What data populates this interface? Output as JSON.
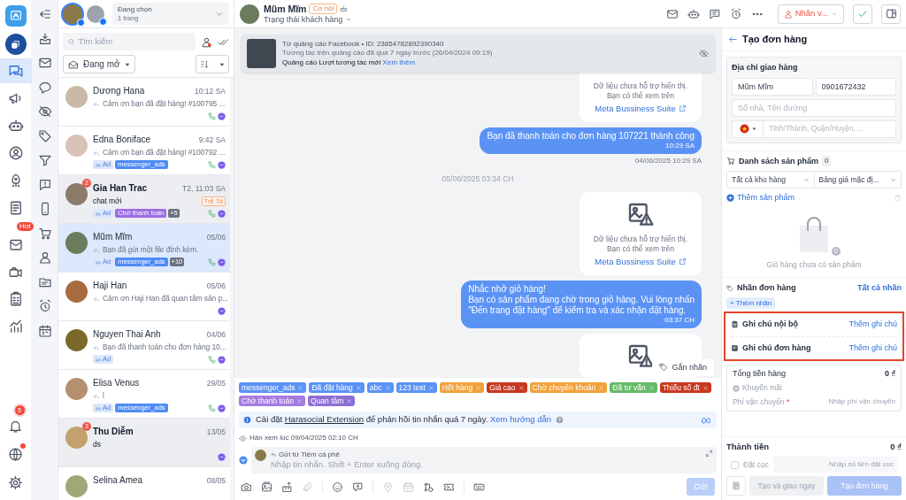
{
  "rail": {
    "items": [
      {
        "selected": true
      },
      {
        "selected": false
      },
      {
        "selected": false
      },
      {
        "selected": false
      },
      {
        "selected": false
      },
      {
        "selected": false
      },
      {
        "selected": false,
        "badge": "Hot"
      },
      {
        "selected": false
      },
      {
        "selected": false
      },
      {
        "selected": false
      }
    ],
    "bottom": [
      {
        "badge": "5",
        "alert": false
      },
      {
        "alert": true
      },
      {
        "alert": false
      }
    ]
  },
  "conversation_list": {
    "pages": {
      "label": "Đang chọn",
      "value": "1 trang"
    },
    "search": {
      "placeholder": "Tìm kiếm"
    },
    "status_filter": "Đang mở",
    "conversations": [
      {
        "name": "Dương Hana",
        "time": "10:12 SA",
        "preview": "Cảm ơn bạn đã đặt hàng! #100795 ...",
        "replied": true,
        "phone": true,
        "selected": false
      },
      {
        "name": "Edna Boniface",
        "time": "9:42 SA",
        "preview": "Cảm ơn bạn đã đặt hàng! #100792 ...",
        "replied": true,
        "tags": [
          {
            "kind": "ad",
            "text": "Ad"
          },
          {
            "kind": "label",
            "text": "messenger_ads",
            "color": "#4f8bf5"
          }
        ],
        "phone": true,
        "selected": false
      },
      {
        "name": "Gia Han Trac",
        "time": "T2, 11:03 SA",
        "preview": "chat mới",
        "replied": false,
        "unread": "2",
        "late": "Trễ 7d",
        "tags": [
          {
            "kind": "ad",
            "text": "Ad"
          },
          {
            "kind": "label",
            "text": "Chờ thanh toán",
            "color": "#9b6fe3"
          },
          {
            "kind": "more",
            "text": "+5"
          }
        ],
        "phone": true,
        "selected": false
      },
      {
        "name": "Mũm Mĩm",
        "time": "05/06",
        "preview": "Bạn đã gửi một file đính kèm.",
        "replied": true,
        "tags": [
          {
            "kind": "ad",
            "text": "Ad"
          },
          {
            "kind": "label",
            "text": "messenger_ads",
            "color": "#4f8bf5"
          },
          {
            "kind": "more",
            "text": "+10"
          }
        ],
        "phone": true,
        "selected": true
      },
      {
        "name": "Haji Han",
        "time": "05/06",
        "preview": "Cảm ơn Haji Han đã quan tâm sản p...",
        "replied": true,
        "phone": false,
        "selected": false
      },
      {
        "name": "Nguyen Thai Anh",
        "time": "04/06",
        "preview": "Bạn đã thanh toán cho đơn hàng 10...",
        "replied": true,
        "tags": [
          {
            "kind": "ad",
            "text": "Ad"
          }
        ],
        "phone": true,
        "selected": false
      },
      {
        "name": "Elisa Venus",
        "time": "29/05",
        "preview": "l",
        "replied": true,
        "tags": [
          {
            "kind": "ad",
            "text": "Ad"
          },
          {
            "kind": "label",
            "text": "messenger_ads",
            "color": "#4f8bf5"
          }
        ],
        "phone": true,
        "selected": false
      },
      {
        "name": "Thu Diễm",
        "time": "13/05",
        "preview": "ds",
        "replied": false,
        "unread": "3",
        "phone": false,
        "selected": false
      },
      {
        "name": "Selina Amea",
        "time": "08/05",
        "selected": false
      }
    ]
  },
  "chat": {
    "contact": {
      "name": "Mũm Mĩm",
      "badge": "Cơ hội",
      "status": "Trạng thái khách hàng"
    },
    "assignee": "Nhân v...",
    "ad_banner": {
      "source": "Từ quảng cáo Facebook • ID: 23854782892390340",
      "note": "Tương tác trên quảng cáo đã quá 7 ngày trước (26/04/2024 09:19)",
      "title": "Quảng cáo Lượt tương tác mới",
      "link": "Xem thêm"
    },
    "messages": [
      {
        "kind": "unsupported",
        "text": "Dữ liệu chưa hỗ trợ hiển thị.\nBạn có thể xem trên",
        "link": "Meta Bussiness Suite"
      },
      {
        "kind": "outgoing",
        "text": "Bạn đã thanh toán cho đơn hàng 107221 thành công",
        "time": "10:29 SA",
        "stamp": "04/06/2025 10:29 SA"
      },
      {
        "kind": "divider",
        "text": "05/06/2025 03:34 CH"
      },
      {
        "kind": "unsupported",
        "text": "Dữ liệu chưa hỗ trợ hiển thị.\nBạn có thể xem trên",
        "link": "Meta Bussiness Suite"
      },
      {
        "kind": "outgoing",
        "text": "Nhắc nhở giỏ hàng!\nBạn có sản phẩm đang chờ trong giỏ hàng. Vui lòng nhấn\n\"Đến trang đặt hàng\" để kiểm tra và xác nhận đặt hàng.",
        "time": "03:37 CH"
      },
      {
        "kind": "unsupported"
      }
    ],
    "tag_button": "Gắn nhãn",
    "tags": [
      {
        "text": "messenger_ads",
        "color": "#5b93f5"
      },
      {
        "text": "Đã đặt hàng",
        "color": "#5b93f5"
      },
      {
        "text": "abc",
        "color": "#5b93f5"
      },
      {
        "text": "123 test",
        "color": "#5b93f5"
      },
      {
        "text": "Hết hàng",
        "color": "#f2a13a"
      },
      {
        "text": "Giá cao",
        "color": "#c8381f"
      },
      {
        "text": "Chờ chuyển khoản",
        "color": "#f2a13a"
      },
      {
        "text": "Đã tư vấn",
        "color": "#66bb6a"
      },
      {
        "text": "Thiếu số đt",
        "color": "#c8381f"
      },
      {
        "text": "Chờ thanh toán",
        "color": "#a57be3"
      },
      {
        "text": "Quan tâm",
        "color": "#8c6fd6"
      }
    ],
    "notice": {
      "before": "Cài đặt",
      "link": "Harasocial Extension",
      "after": "để phản hồi tin nhắn quá 7 ngày.",
      "help": "Xem hướng dẫn"
    },
    "seen": "Hân xem lúc 09/04/2025 02:10 CH",
    "composer": {
      "sender": "Gửi từ Tiệm cà phê",
      "placeholder": "Nhập tin nhắn. Shift + Enter xuống dòng.",
      "send": "Gửi",
      "send_disabled": true
    }
  },
  "order": {
    "title": "Tạo đơn hàng",
    "address": {
      "title": "Địa chỉ giao hàng",
      "name": "Mũm Mĩm",
      "phone": "0901672432",
      "street_placeholder": "Số nhà, Tên đường",
      "region_placeholder": "Tỉnh/Thành, Quận/Huyện, ..."
    },
    "products": {
      "title": "Danh sách sản phẩm",
      "count": "0",
      "warehouse": "Tất cả kho hàng",
      "price_list": "Bảng giá mặc đị...",
      "add": "Thêm sản phẩm",
      "cart_count": "0",
      "empty": "Giỏ hàng chưa có sản phẩm"
    },
    "labels": {
      "title": "Nhãn đơn hàng",
      "all": "Tất cả nhãn",
      "add": "+ Thêm nhãn"
    },
    "notes": [
      {
        "label": "Ghi chú nội bộ",
        "action": "Thêm ghi chú"
      },
      {
        "label": "Ghi chú đơn hàng",
        "action": "Thêm ghi chú"
      }
    ],
    "summary": {
      "subtotal_label": "Tổng tiền hàng",
      "subtotal": "0 ₫",
      "discount": "Khuyến mãi",
      "shipping_label": "Phí vận chuyển",
      "shipping_required": "*",
      "shipping_placeholder": "Nhập phí vận chuyển"
    },
    "total_label": "Thành tiền",
    "total": "0 ₫",
    "deposit": {
      "label": "Đặt cọc",
      "checked": false,
      "placeholder": "Nhập số tiền đặt cọc"
    },
    "buttons": {
      "create_ship": "Tạo và giao ngay",
      "create": "Tạo đơn hàng"
    }
  }
}
